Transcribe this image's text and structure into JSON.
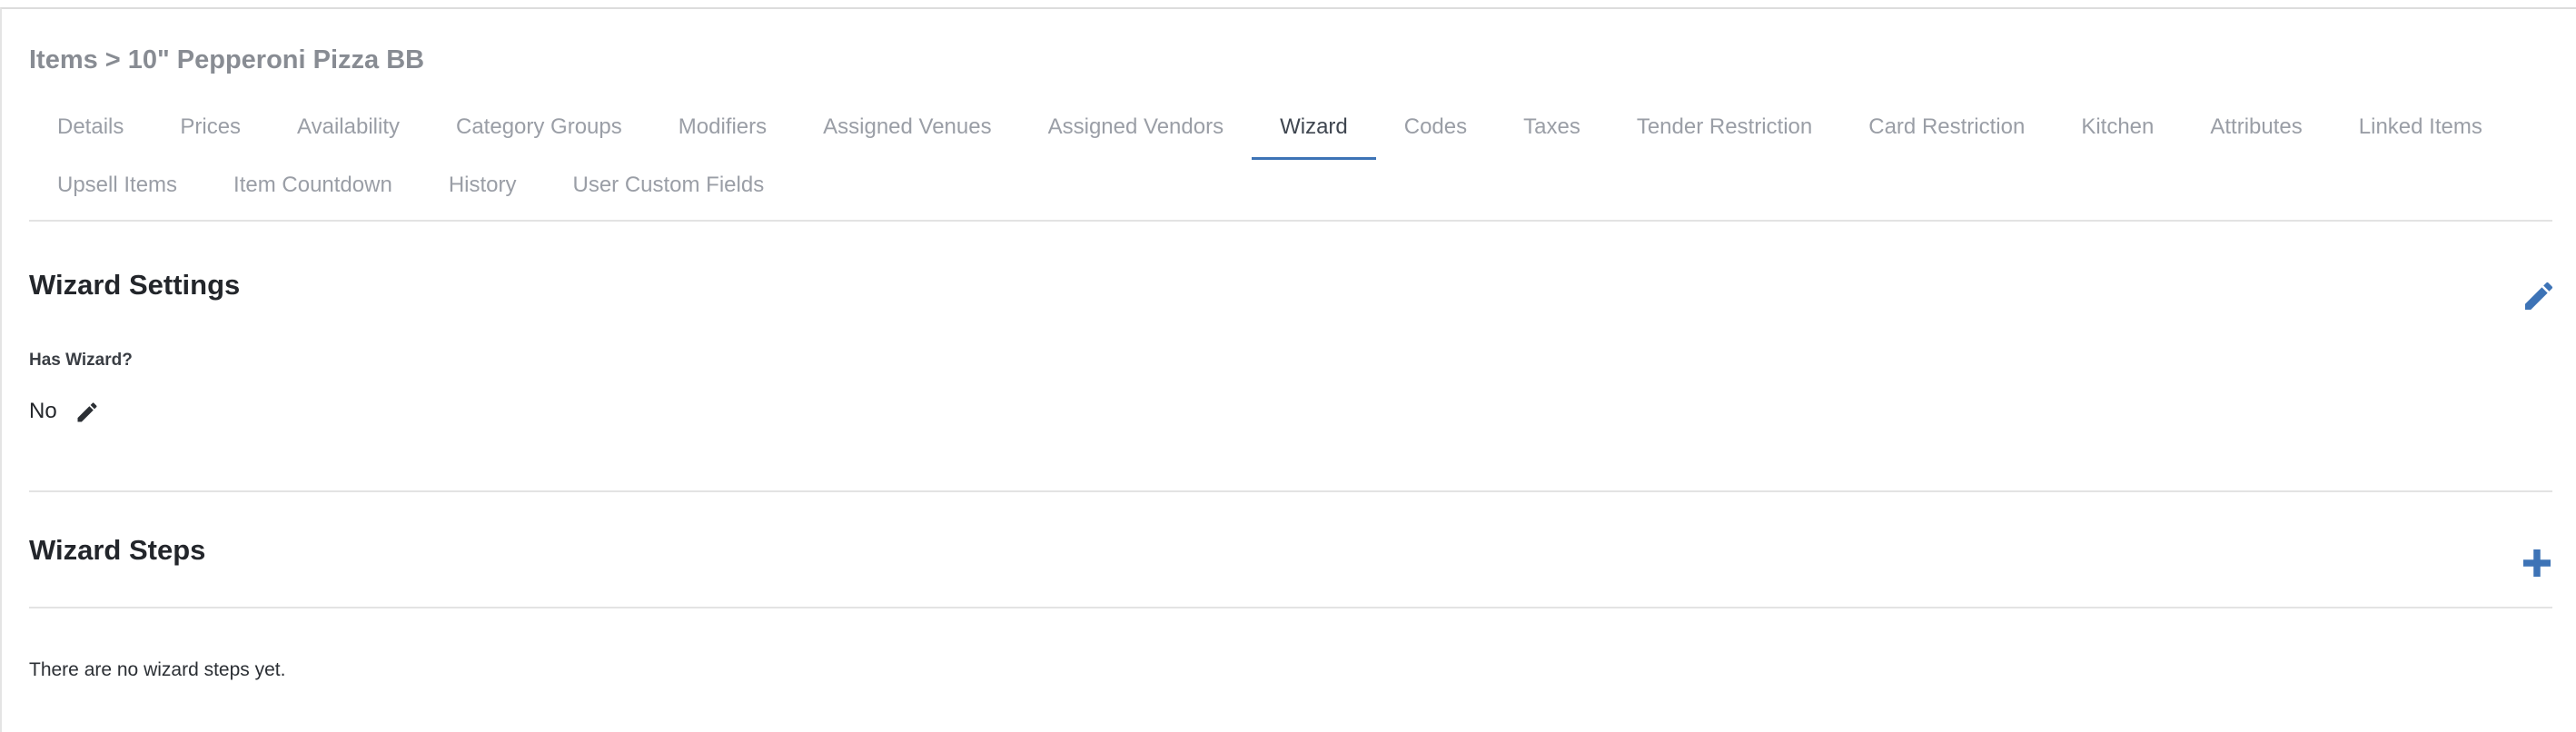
{
  "breadcrumb": {
    "parent": "Items",
    "separator": ">",
    "current": "10\" Pepperoni Pizza BB"
  },
  "tabs": {
    "row1": [
      {
        "label": "Details"
      },
      {
        "label": "Prices"
      },
      {
        "label": "Availability"
      },
      {
        "label": "Category Groups"
      },
      {
        "label": "Modifiers"
      },
      {
        "label": "Assigned Venues"
      },
      {
        "label": "Assigned Vendors"
      },
      {
        "label": "Wizard"
      },
      {
        "label": "Codes"
      },
      {
        "label": "Taxes"
      },
      {
        "label": "Tender Restriction"
      },
      {
        "label": "Card Restriction"
      },
      {
        "label": "Kitchen"
      },
      {
        "label": "Attributes"
      },
      {
        "label": "Linked Items"
      }
    ],
    "row2": [
      {
        "label": "Upsell Items"
      },
      {
        "label": "Item Countdown"
      },
      {
        "label": "History"
      },
      {
        "label": "User Custom Fields"
      }
    ],
    "active": "Wizard"
  },
  "wizard_settings": {
    "title": "Wizard Settings",
    "field_label": "Has Wizard?",
    "field_value": "No",
    "edit_icon": "pencil-icon"
  },
  "wizard_steps": {
    "title": "Wizard Steps",
    "add_icon": "plus-icon",
    "empty_message": "There are no wizard steps yet."
  },
  "colors": {
    "accent": "#3d73b6",
    "muted_text": "#9a9ea6",
    "divider": "#e3e3e3"
  }
}
